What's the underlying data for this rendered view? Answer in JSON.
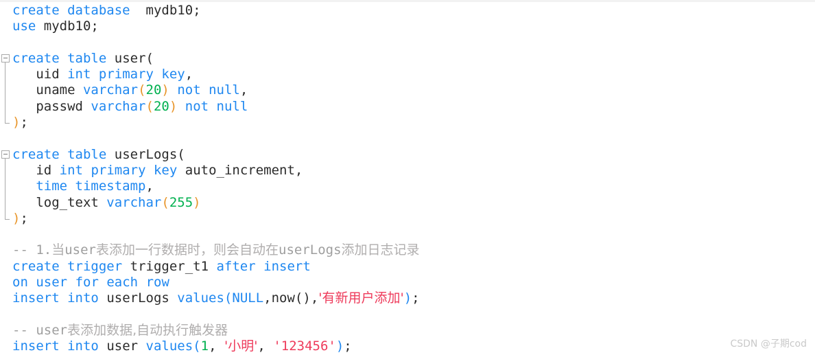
{
  "editor": {
    "language": "sql",
    "colors": {
      "keyword": "#1E87F0",
      "identifier": "#2b2b2b",
      "number": "#00B04F",
      "string": "#EE3B5B",
      "comment": "#9e9e9e",
      "paren_orange": "#E8952A",
      "background": "#ffffff"
    }
  },
  "watermark": {
    "text": "CSDN @子期cod"
  },
  "fold_widgets": [
    {
      "name": "fold-create-table-user",
      "state": "expanded",
      "glyph": "minus"
    },
    {
      "name": "fold-create-table-userlogs",
      "state": "expanded",
      "glyph": "minus"
    }
  ],
  "code": {
    "lines": [
      {
        "n": 1,
        "text": "create database  mydb10;",
        "tokens": [
          {
            "t": "create",
            "c": "kw"
          },
          {
            "t": " ",
            "c": "punc"
          },
          {
            "t": "database",
            "c": "kw"
          },
          {
            "t": "  ",
            "c": "punc"
          },
          {
            "t": "mydb10",
            "c": "id"
          },
          {
            "t": ";",
            "c": "punc"
          }
        ]
      },
      {
        "n": 2,
        "text": "use mydb10;",
        "tokens": [
          {
            "t": "use",
            "c": "kw"
          },
          {
            "t": " ",
            "c": "punc"
          },
          {
            "t": "mydb10",
            "c": "id"
          },
          {
            "t": ";",
            "c": "punc"
          }
        ]
      },
      {
        "n": 3,
        "text": "",
        "tokens": []
      },
      {
        "n": 4,
        "text": "create table user(",
        "tokens": [
          {
            "t": "create",
            "c": "kw"
          },
          {
            "t": " ",
            "c": "punc"
          },
          {
            "t": "table",
            "c": "kw"
          },
          {
            "t": " ",
            "c": "punc"
          },
          {
            "t": "user",
            "c": "id"
          },
          {
            "t": "(",
            "c": "punc"
          }
        ]
      },
      {
        "n": 5,
        "text": "   uid int primary key,",
        "tokens": [
          {
            "t": "   ",
            "c": "punc"
          },
          {
            "t": "uid",
            "c": "id"
          },
          {
            "t": " ",
            "c": "punc"
          },
          {
            "t": "int",
            "c": "kw"
          },
          {
            "t": " ",
            "c": "punc"
          },
          {
            "t": "primary",
            "c": "kw"
          },
          {
            "t": " ",
            "c": "punc"
          },
          {
            "t": "key",
            "c": "kw"
          },
          {
            "t": ",",
            "c": "punc"
          }
        ]
      },
      {
        "n": 6,
        "text": "   uname varchar(20) not null,",
        "tokens": [
          {
            "t": "   ",
            "c": "punc"
          },
          {
            "t": "uname",
            "c": "id"
          },
          {
            "t": " ",
            "c": "punc"
          },
          {
            "t": "varchar",
            "c": "kw"
          },
          {
            "t": "(",
            "c": "paren-o"
          },
          {
            "t": "20",
            "c": "num"
          },
          {
            "t": ")",
            "c": "paren-o"
          },
          {
            "t": " ",
            "c": "punc"
          },
          {
            "t": "not",
            "c": "kw"
          },
          {
            "t": " ",
            "c": "punc"
          },
          {
            "t": "null",
            "c": "kw"
          },
          {
            "t": ",",
            "c": "punc"
          }
        ]
      },
      {
        "n": 7,
        "text": "   passwd varchar(20) not null",
        "tokens": [
          {
            "t": "   ",
            "c": "punc"
          },
          {
            "t": "passwd",
            "c": "id"
          },
          {
            "t": " ",
            "c": "punc"
          },
          {
            "t": "varchar",
            "c": "kw"
          },
          {
            "t": "(",
            "c": "paren-o"
          },
          {
            "t": "20",
            "c": "num"
          },
          {
            "t": ")",
            "c": "paren-o"
          },
          {
            "t": " ",
            "c": "punc"
          },
          {
            "t": "not",
            "c": "kw"
          },
          {
            "t": " ",
            "c": "punc"
          },
          {
            "t": "null",
            "c": "kw"
          }
        ]
      },
      {
        "n": 8,
        "text": ");",
        "tokens": [
          {
            "t": ")",
            "c": "paren-o"
          },
          {
            "t": ";",
            "c": "punc"
          }
        ]
      },
      {
        "n": 9,
        "text": "",
        "tokens": []
      },
      {
        "n": 10,
        "text": "create table userLogs(",
        "tokens": [
          {
            "t": "create",
            "c": "kw"
          },
          {
            "t": " ",
            "c": "punc"
          },
          {
            "t": "table",
            "c": "kw"
          },
          {
            "t": " ",
            "c": "punc"
          },
          {
            "t": "userLogs",
            "c": "id"
          },
          {
            "t": "(",
            "c": "punc"
          }
        ]
      },
      {
        "n": 11,
        "text": "   id int primary key auto_increment,",
        "tokens": [
          {
            "t": "   ",
            "c": "punc"
          },
          {
            "t": "id",
            "c": "id"
          },
          {
            "t": " ",
            "c": "punc"
          },
          {
            "t": "int",
            "c": "kw"
          },
          {
            "t": " ",
            "c": "punc"
          },
          {
            "t": "primary",
            "c": "kw"
          },
          {
            "t": " ",
            "c": "punc"
          },
          {
            "t": "key",
            "c": "kw"
          },
          {
            "t": " ",
            "c": "punc"
          },
          {
            "t": "auto_increment",
            "c": "id"
          },
          {
            "t": ",",
            "c": "punc"
          }
        ]
      },
      {
        "n": 12,
        "text": "   time timestamp,",
        "tokens": [
          {
            "t": "   ",
            "c": "punc"
          },
          {
            "t": "time",
            "c": "kw"
          },
          {
            "t": " ",
            "c": "punc"
          },
          {
            "t": "timestamp",
            "c": "kw"
          },
          {
            "t": ",",
            "c": "punc"
          }
        ]
      },
      {
        "n": 13,
        "text": "   log_text varchar(255)",
        "tokens": [
          {
            "t": "   ",
            "c": "punc"
          },
          {
            "t": "log_text",
            "c": "id"
          },
          {
            "t": " ",
            "c": "punc"
          },
          {
            "t": "varchar",
            "c": "kw"
          },
          {
            "t": "(",
            "c": "paren-o"
          },
          {
            "t": "255",
            "c": "num"
          },
          {
            "t": ")",
            "c": "paren-o"
          }
        ]
      },
      {
        "n": 14,
        "text": ");",
        "tokens": [
          {
            "t": ")",
            "c": "paren-o"
          },
          {
            "t": ";",
            "c": "punc"
          }
        ]
      },
      {
        "n": 15,
        "text": "",
        "tokens": []
      },
      {
        "n": 16,
        "text": "-- 1.当user表添加一行数据时，则会自动在userLogs添加日志记录",
        "tokens": [
          {
            "t": "-- 1.",
            "c": "cmt"
          },
          {
            "t": "当",
            "c": "cmt-cjk"
          },
          {
            "t": "user",
            "c": "cmt"
          },
          {
            "t": "表添加一行数据时，则会自动在",
            "c": "cmt-cjk"
          },
          {
            "t": "userLogs",
            "c": "cmt"
          },
          {
            "t": "添加日志记录",
            "c": "cmt-cjk"
          }
        ]
      },
      {
        "n": 17,
        "text": "create trigger trigger_t1 after insert",
        "tokens": [
          {
            "t": "create",
            "c": "kw"
          },
          {
            "t": " ",
            "c": "punc"
          },
          {
            "t": "trigger",
            "c": "kw"
          },
          {
            "t": " ",
            "c": "punc"
          },
          {
            "t": "trigger_t1",
            "c": "id"
          },
          {
            "t": " ",
            "c": "punc"
          },
          {
            "t": "after",
            "c": "kw"
          },
          {
            "t": " ",
            "c": "punc"
          },
          {
            "t": "insert",
            "c": "kw"
          }
        ]
      },
      {
        "n": 18,
        "text": "on user for each row",
        "tokens": [
          {
            "t": "on",
            "c": "kw"
          },
          {
            "t": " ",
            "c": "punc"
          },
          {
            "t": "user",
            "c": "kw"
          },
          {
            "t": " ",
            "c": "punc"
          },
          {
            "t": "for",
            "c": "kw"
          },
          {
            "t": " ",
            "c": "punc"
          },
          {
            "t": "each",
            "c": "kw"
          },
          {
            "t": " ",
            "c": "punc"
          },
          {
            "t": "row",
            "c": "kw"
          }
        ]
      },
      {
        "n": 19,
        "text": "insert into userLogs values(NULL,now(),'有新用户添加');",
        "tokens": [
          {
            "t": "insert",
            "c": "kw"
          },
          {
            "t": " ",
            "c": "punc"
          },
          {
            "t": "into",
            "c": "kw"
          },
          {
            "t": " ",
            "c": "punc"
          },
          {
            "t": "userLogs",
            "c": "id"
          },
          {
            "t": " ",
            "c": "punc"
          },
          {
            "t": "values",
            "c": "kw"
          },
          {
            "t": "(",
            "c": "paren-b"
          },
          {
            "t": "NULL",
            "c": "kw"
          },
          {
            "t": ",",
            "c": "punc"
          },
          {
            "t": "now",
            "c": "id"
          },
          {
            "t": "()",
            "c": "punc"
          },
          {
            "t": ",",
            "c": "punc"
          },
          {
            "t": "'有新用户添加'",
            "c": "str"
          },
          {
            "t": ")",
            "c": "paren-b"
          },
          {
            "t": ";",
            "c": "punc"
          }
        ]
      },
      {
        "n": 20,
        "text": "",
        "tokens": []
      },
      {
        "n": 21,
        "text": "-- user表添加数据,自动执行触发器",
        "tokens": [
          {
            "t": "-- ",
            "c": "cmt"
          },
          {
            "t": "user",
            "c": "cmt"
          },
          {
            "t": "表添加数据,自动执行触发器",
            "c": "cmt-cjk"
          }
        ]
      },
      {
        "n": 22,
        "text": "insert into user values(1, '小明', '123456');",
        "tokens": [
          {
            "t": "insert",
            "c": "kw"
          },
          {
            "t": " ",
            "c": "punc"
          },
          {
            "t": "into",
            "c": "kw"
          },
          {
            "t": " ",
            "c": "punc"
          },
          {
            "t": "user",
            "c": "id"
          },
          {
            "t": " ",
            "c": "punc"
          },
          {
            "t": "values",
            "c": "kw"
          },
          {
            "t": "(",
            "c": "paren-b"
          },
          {
            "t": "1",
            "c": "num"
          },
          {
            "t": ", ",
            "c": "punc"
          },
          {
            "t": "'小明'",
            "c": "str"
          },
          {
            "t": ", ",
            "c": "punc"
          },
          {
            "t": "'123456'",
            "c": "str"
          },
          {
            "t": ")",
            "c": "paren-b"
          },
          {
            "t": ";",
            "c": "punc"
          }
        ]
      }
    ]
  }
}
